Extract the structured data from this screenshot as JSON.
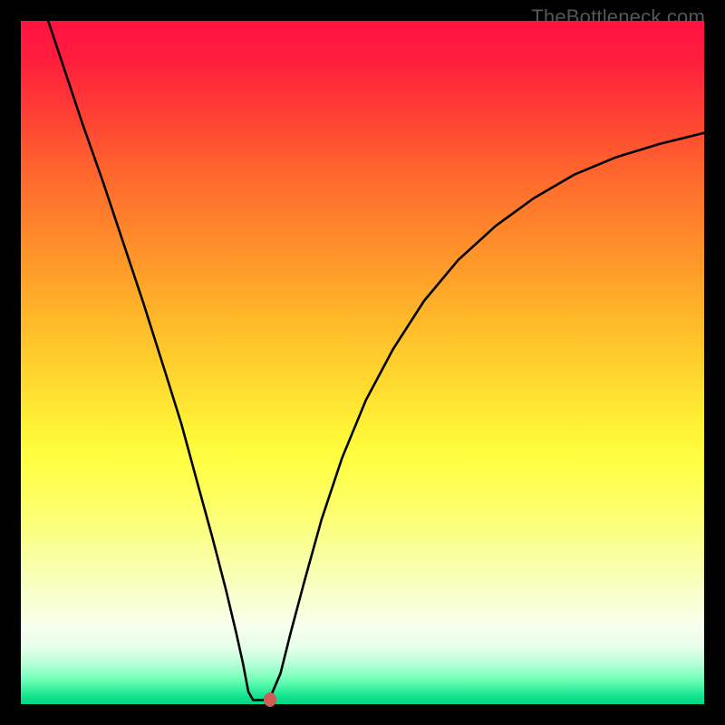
{
  "watermark": "TheBottleneck.com",
  "chart_data": {
    "type": "line",
    "title": "",
    "xlabel": "",
    "ylabel": "",
    "x_range": [
      0,
      1
    ],
    "y_range": [
      0,
      1
    ],
    "series": [
      {
        "name": "bottleneck-curve",
        "points": [
          {
            "x": 0.04,
            "y": 1.0
          },
          {
            "x": 0.065,
            "y": 0.925
          },
          {
            "x": 0.09,
            "y": 0.85
          },
          {
            "x": 0.12,
            "y": 0.765
          },
          {
            "x": 0.15,
            "y": 0.675
          },
          {
            "x": 0.18,
            "y": 0.585
          },
          {
            "x": 0.21,
            "y": 0.49
          },
          {
            "x": 0.235,
            "y": 0.41
          },
          {
            "x": 0.26,
            "y": 0.318
          },
          {
            "x": 0.28,
            "y": 0.245
          },
          {
            "x": 0.3,
            "y": 0.168
          },
          {
            "x": 0.315,
            "y": 0.105
          },
          {
            "x": 0.325,
            "y": 0.06
          },
          {
            "x": 0.333,
            "y": 0.018
          },
          {
            "x": 0.34,
            "y": 0.006
          },
          {
            "x": 0.355,
            "y": 0.006
          },
          {
            "x": 0.365,
            "y": 0.01
          },
          {
            "x": 0.38,
            "y": 0.045
          },
          {
            "x": 0.395,
            "y": 0.105
          },
          {
            "x": 0.415,
            "y": 0.18
          },
          {
            "x": 0.44,
            "y": 0.27
          },
          {
            "x": 0.47,
            "y": 0.36
          },
          {
            "x": 0.505,
            "y": 0.445
          },
          {
            "x": 0.545,
            "y": 0.52
          },
          {
            "x": 0.59,
            "y": 0.59
          },
          {
            "x": 0.64,
            "y": 0.65
          },
          {
            "x": 0.695,
            "y": 0.7
          },
          {
            "x": 0.75,
            "y": 0.74
          },
          {
            "x": 0.81,
            "y": 0.775
          },
          {
            "x": 0.87,
            "y": 0.8
          },
          {
            "x": 0.935,
            "y": 0.82
          },
          {
            "x": 1.0,
            "y": 0.836
          }
        ]
      }
    ],
    "marker": {
      "x": 0.365,
      "y": 0.007,
      "color": "#cd5d55"
    },
    "gradient_stops": [
      {
        "p": 0.0,
        "c": "#ff1242"
      },
      {
        "p": 0.33,
        "c": "#ff8e2a"
      },
      {
        "p": 0.6,
        "c": "#fff438"
      },
      {
        "p": 0.85,
        "c": "#f8ffd5"
      },
      {
        "p": 1.0,
        "c": "#00d782"
      }
    ],
    "background": "#000000"
  }
}
